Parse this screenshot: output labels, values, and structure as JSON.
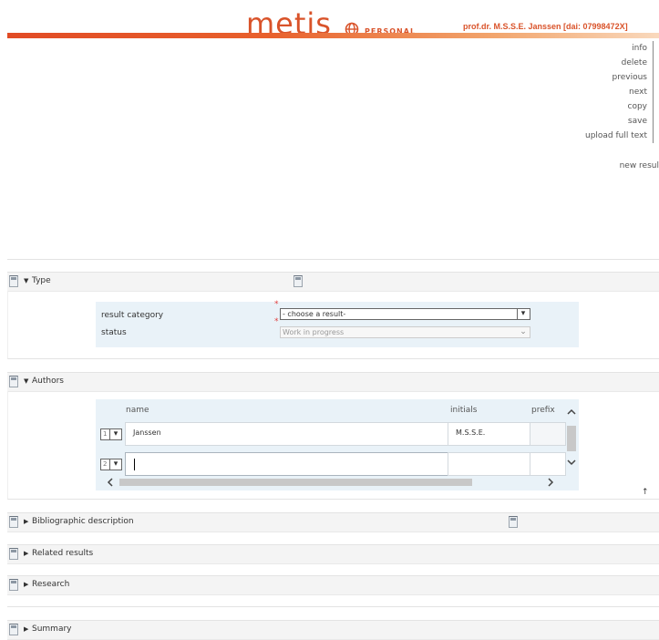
{
  "header": {
    "logo_text": "metis",
    "logo_sub": "PERSONAL",
    "user": "prof.dr. M.S.S.E. Janssen [dai: 07998472X]",
    "brand_color": "#d9532a"
  },
  "actions": [
    "info",
    "delete",
    "previous",
    "next",
    "copy",
    "save",
    "upload full text"
  ],
  "new_result": "new resul",
  "type_section": {
    "label": "Type",
    "result_category_label": "result category",
    "result_category_value": "- choose a result-",
    "status_label": "status",
    "status_value": "Work in progress"
  },
  "authors_section": {
    "label": "Authors",
    "columns": [
      "name",
      "initials",
      "prefix"
    ],
    "rows": [
      {
        "num": "1",
        "name": "Janssen",
        "initials": "M.S.S.E."
      },
      {
        "num": "2",
        "name": "",
        "initials": ""
      }
    ]
  },
  "sections": {
    "bibliographic": "Bibliographic description",
    "related": "Related results",
    "research": "Research",
    "summary": "Summary"
  },
  "icons": {
    "expanded": "triangle-down-icon",
    "collapsed": "triangle-right-icon",
    "document": "document-icon"
  }
}
